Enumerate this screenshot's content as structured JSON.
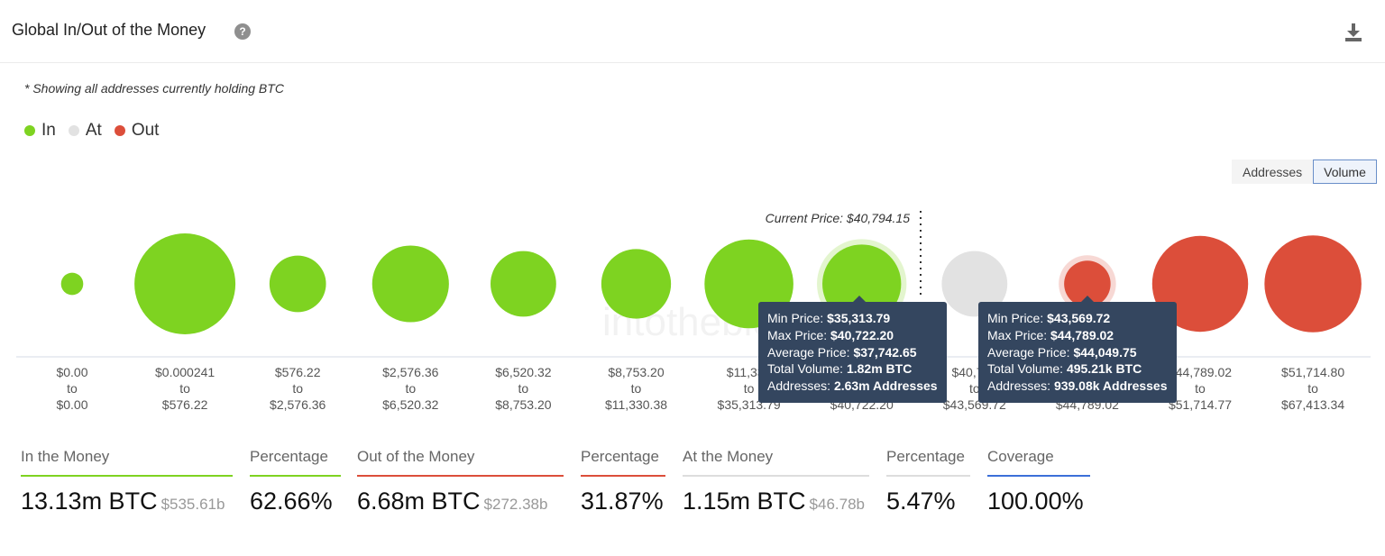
{
  "header": {
    "title": "Global In/Out of the Money",
    "help_icon": "question-circle-icon",
    "download_icon": "download-icon"
  },
  "note": "* Showing all addresses currently holding BTC",
  "legend": [
    {
      "label": "In",
      "color": "#7ed321"
    },
    {
      "label": "At",
      "color": "#e2e2e2"
    },
    {
      "label": "Out",
      "color": "#dc4e3a"
    }
  ],
  "toggle": {
    "addresses_label": "Addresses",
    "volume_label": "Volume",
    "active": "Volume"
  },
  "chart_data": {
    "type": "bubble",
    "current_price_label": "Current Price: $40,794.15",
    "current_price": 40794.15,
    "size_metric": "Total Volume",
    "bubbles": [
      {
        "range": [
          "$0.00",
          "to",
          "$0.00"
        ],
        "status": "in",
        "size": 0.22
      },
      {
        "range": [
          "$0.000241",
          "to",
          "$576.22"
        ],
        "status": "in",
        "size": 1.0
      },
      {
        "range": [
          "$576.22",
          "to",
          "$2,576.36"
        ],
        "status": "in",
        "size": 0.56
      },
      {
        "range": [
          "$2,576.36",
          "to",
          "$6,520.32"
        ],
        "status": "in",
        "size": 0.76
      },
      {
        "range": [
          "$6,520.32",
          "to",
          "$8,753.20"
        ],
        "status": "in",
        "size": 0.65
      },
      {
        "range": [
          "$8,753.20",
          "to",
          "$11,330.38"
        ],
        "status": "in",
        "size": 0.69
      },
      {
        "range": [
          "$11,330",
          "to",
          "$35,313.79"
        ],
        "status": "in",
        "size": 0.88
      },
      {
        "range": [
          "$35,313.79",
          "to",
          "$40,722.20"
        ],
        "status": "in",
        "size": 0.78,
        "highlight": true
      },
      {
        "range": [
          "$40,722",
          "to",
          "$43,569.72"
        ],
        "status": "at",
        "size": 0.65
      },
      {
        "range": [
          "$43,569.72",
          "to",
          "$44,789.02"
        ],
        "status": "out",
        "size": 0.46,
        "highlight": true
      },
      {
        "range": [
          "$44,789.02",
          "to",
          "$51,714.77"
        ],
        "status": "out",
        "size": 0.95
      },
      {
        "range": [
          "$51,714.80",
          "to",
          "$67,413.34"
        ],
        "status": "out",
        "size": 0.96
      }
    ],
    "watermark": "intotheblock"
  },
  "tooltips": [
    {
      "min_label": "Min Price:",
      "min_value": "$35,313.79",
      "max_label": "Max Price:",
      "max_value": "$40,722.20",
      "avg_label": "Average Price:",
      "avg_value": "$37,742.65",
      "vol_label": "Total Volume:",
      "vol_value": "1.82m BTC",
      "addr_label": "Addresses:",
      "addr_value": "2.63m Addresses"
    },
    {
      "min_label": "Min Price:",
      "min_value": "$43,569.72",
      "max_label": "Max Price:",
      "max_value": "$44,789.02",
      "avg_label": "Average Price:",
      "avg_value": "$44,049.75",
      "vol_label": "Total Volume:",
      "vol_value": "495.21k BTC",
      "addr_label": "Addresses:",
      "addr_value": "939.08k Addresses"
    }
  ],
  "stats": [
    {
      "label": "In the Money",
      "value": "13.13m BTC",
      "sub": "$535.61b",
      "color": "#7ed321"
    },
    {
      "label": "Percentage",
      "value": "62.66%",
      "sub": "",
      "color": "#7ed321"
    },
    {
      "label": "Out of the Money",
      "value": "6.68m BTC",
      "sub": "$272.38b",
      "color": "#dc4e3a"
    },
    {
      "label": "Percentage",
      "value": "31.87%",
      "sub": "",
      "color": "#dc4e3a"
    },
    {
      "label": "At the Money",
      "value": "1.15m BTC",
      "sub": "$46.78b",
      "color": "#dddddd"
    },
    {
      "label": "Percentage",
      "value": "5.47%",
      "sub": "",
      "color": "#dddddd"
    },
    {
      "label": "Coverage",
      "value": "100.00%",
      "sub": "",
      "color": "#3b6fd8"
    }
  ]
}
